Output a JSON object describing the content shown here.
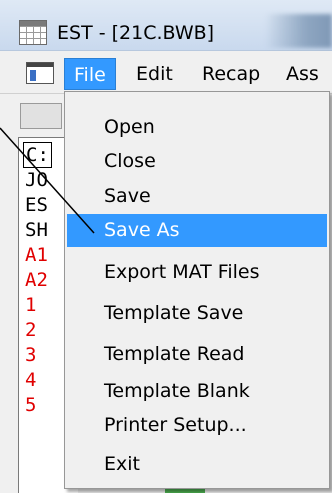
{
  "window": {
    "title": "EST - [21C.BWB]",
    "app_icon": "spreadsheet-icon"
  },
  "menubar": {
    "system_icon": "window-icon",
    "items": [
      {
        "label": "File",
        "active": true
      },
      {
        "label": "Edit"
      },
      {
        "label": "Recap"
      },
      {
        "label": "Ass"
      }
    ]
  },
  "left_panel": {
    "rows": [
      {
        "text": "C:",
        "color": "#000000"
      },
      {
        "text": "JO",
        "color": "#000000"
      },
      {
        "text": "ES",
        "color": "#000000"
      },
      {
        "text": "SH",
        "color": "#000000"
      },
      {
        "text": "A1",
        "color": "#e00000"
      },
      {
        "text": "A2",
        "color": "#e00000"
      },
      {
        "text": "1",
        "color": "#e00000"
      },
      {
        "text": "2",
        "color": "#e00000"
      },
      {
        "text": "3",
        "color": "#e00000"
      },
      {
        "text": "4",
        "color": "#e00000"
      },
      {
        "text": "5",
        "color": "#e00000"
      }
    ]
  },
  "file_menu": {
    "items": [
      {
        "label": "Open"
      },
      {
        "label": "Close"
      },
      {
        "label": "Save"
      },
      {
        "label": "Save As",
        "highlighted": true
      },
      {
        "label": "Export MAT Files"
      },
      {
        "label": "Template Save"
      },
      {
        "label": "Template Read"
      },
      {
        "label": "Template Blank"
      },
      {
        "label": "Printer Setup..."
      },
      {
        "label": "Exit"
      }
    ]
  },
  "colors": {
    "highlight": "#3399ff",
    "menu_background": "#f0f0f0",
    "red_text": "#e00000"
  }
}
